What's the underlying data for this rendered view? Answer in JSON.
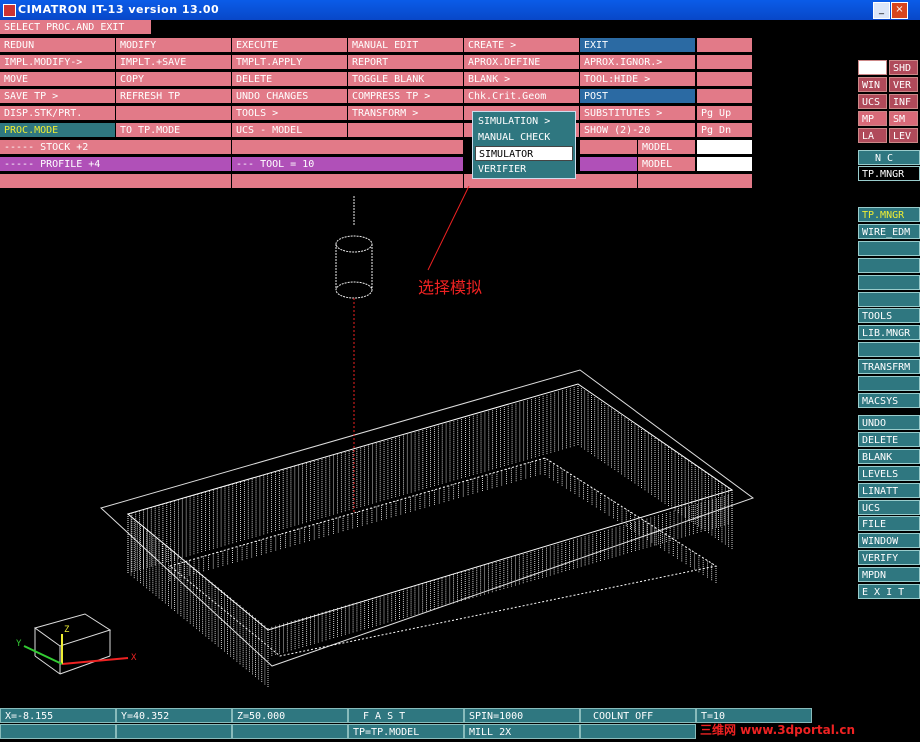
{
  "window": {
    "title": "CIMATRON IT-13 version 13.00",
    "min": "_",
    "max": "□",
    "close": "×"
  },
  "top_bar": {
    "label": "SELECT PROC.AND EXIT"
  },
  "menu": [
    [
      "REDUN",
      "MODIFY",
      "EXECUTE",
      "MANUAL EDIT",
      "CREATE   >",
      "EXIT"
    ],
    [
      "IMPL.MODIFY->",
      "IMPLT.+SAVE",
      "TMPLT.APPLY",
      "REPORT",
      "APROX.DEFINE",
      "APROX.IGNOR.>"
    ],
    [
      "MOVE",
      "COPY",
      "DELETE",
      "TOGGLE BLANK",
      "BLANK     >",
      "TOOL:HIDE   >"
    ],
    [
      "SAVE TP      >",
      "REFRESH TP",
      "UNDO CHANGES",
      "COMPRESS TP >",
      "Chk.Crit.Geom",
      "POST"
    ],
    [
      "DISP.STK/PRT.",
      "",
      "TOOLS        >",
      "TRANSFORM   >",
      "",
      "SUBSTITUTES  >"
    ],
    [
      "PROC.MODE",
      "TO TP.MODE",
      "UCS - MODEL",
      "",
      "",
      "SHOW (2)-20"
    ]
  ],
  "menu_extra": {
    "pg_up": "Pg Up",
    "pg_dn": "Pg Dn"
  },
  "stock_row": {
    "stock": "-----       STOCK    +2",
    "model1": "MODEL",
    "model2": "MODEL"
  },
  "profile_row": {
    "profile": "-----         PROFILE +4",
    "tool": "--- TOOL = 10"
  },
  "popup": {
    "items": [
      "SIMULATION  >",
      "MANUAL CHECK",
      "SIMULATOR",
      "VERIFIER"
    ],
    "selected": 2
  },
  "right_panel": {
    "toggles": [
      [
        "",
        "SHD"
      ],
      [
        "WIN",
        "VER"
      ],
      [
        "UCS",
        "INF"
      ],
      [
        "MP",
        "SM"
      ],
      [
        "LA",
        "LEV"
      ]
    ],
    "nc": "N C",
    "tp_mngr": "TP.MNGR",
    "group1": [
      "TP.MNGR",
      "WIRE_EDM",
      "",
      "",
      "",
      "",
      "TOOLS",
      "LIB.MNGR",
      "",
      "TRANSFRM",
      "",
      "MACSYS"
    ],
    "group2": [
      "UNDO",
      "DELETE",
      "BLANK",
      "LEVELS",
      "LINATT",
      "UCS",
      "FILE",
      "WINDOW",
      "VERIFY",
      "MPDN",
      "E X I T"
    ]
  },
  "status": {
    "x": "X=-8.155",
    "y": "Y=40.352",
    "z": "Z=50.000",
    "fast": "F A S T",
    "spin": "SPIN=1000",
    "coolnt": "COOLNT OFF",
    "t": "T=10",
    "tp_model": "TP=TP.MODEL",
    "mill": "MILL 2X"
  },
  "annotation": "选择模拟",
  "watermark": "三维网 www.3dportal.cn",
  "axes": {
    "x": "X",
    "y": "Y",
    "z": "Z"
  }
}
